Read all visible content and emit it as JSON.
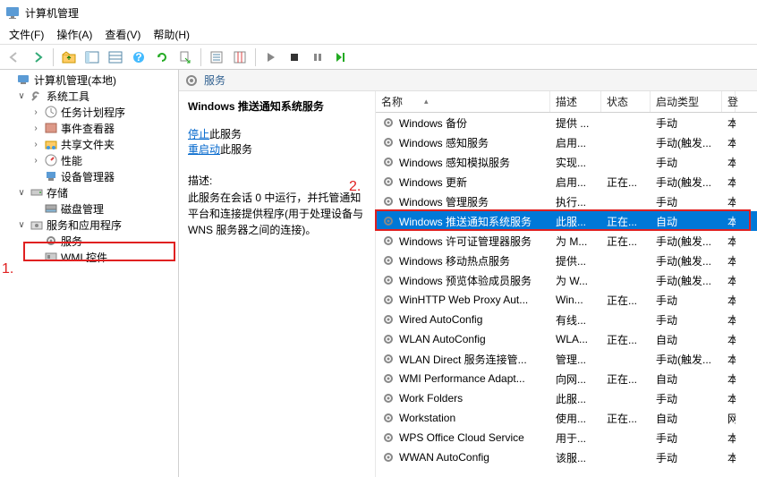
{
  "window": {
    "title": "计算机管理"
  },
  "menu": {
    "file": "文件(F)",
    "action": "操作(A)",
    "view": "查看(V)",
    "help": "帮助(H)"
  },
  "toolbar_icons": [
    "back",
    "forward",
    "up",
    "show-hide",
    "view-list",
    "help",
    "refresh",
    "export",
    "properties",
    "columns",
    "play",
    "stop",
    "pause",
    "restart"
  ],
  "tree": {
    "root": "计算机管理(本地)",
    "sys_tools": "系统工具",
    "task_sched": "任务计划程序",
    "event_viewer": "事件查看器",
    "shared": "共享文件夹",
    "perf": "性能",
    "devmgr": "设备管理器",
    "storage": "存储",
    "diskmgmt": "磁盘管理",
    "svc_apps": "服务和应用程序",
    "services": "服务",
    "wmi": "WMI 控件"
  },
  "annotations": {
    "a1": "1.",
    "a2": "2."
  },
  "svchdr": {
    "title": "服务"
  },
  "detail": {
    "name": "Windows 推送通知系统服务",
    "stop_pre": "停止",
    "stop_post": "此服务",
    "restart_pre": "重启动",
    "restart_post": "此服务",
    "desc_label": "描述:",
    "desc_text": "此服务在会话 0 中运行，并托管通知平台和连接提供程序(用于处理设备与 WNS 服务器之间的连接)。"
  },
  "cols": {
    "name": "名称",
    "desc": "描述",
    "stat": "状态",
    "start": "启动类型",
    "logon": "登"
  },
  "services": [
    {
      "name": "Windows 备份",
      "desc": "提供 ...",
      "stat": "",
      "start": "手动",
      "logon": "本"
    },
    {
      "name": "Windows 感知服务",
      "desc": "启用...",
      "stat": "",
      "start": "手动(触发...",
      "logon": "本"
    },
    {
      "name": "Windows 感知模拟服务",
      "desc": "实现...",
      "stat": "",
      "start": "手动",
      "logon": "本"
    },
    {
      "name": "Windows 更新",
      "desc": "启用...",
      "stat": "正在...",
      "start": "手动(触发...",
      "logon": "本"
    },
    {
      "name": "Windows 管理服务",
      "desc": "执行...",
      "stat": "",
      "start": "手动",
      "logon": "本"
    },
    {
      "name": "Windows 推送通知系统服务",
      "desc": "此服...",
      "stat": "正在...",
      "start": "自动",
      "logon": "本",
      "selected": true
    },
    {
      "name": "Windows 许可证管理器服务",
      "desc": "为 M...",
      "stat": "正在...",
      "start": "手动(触发...",
      "logon": "本"
    },
    {
      "name": "Windows 移动热点服务",
      "desc": "提供...",
      "stat": "",
      "start": "手动(触发...",
      "logon": "本"
    },
    {
      "name": "Windows 预览体验成员服务",
      "desc": "为 W...",
      "stat": "",
      "start": "手动(触发...",
      "logon": "本"
    },
    {
      "name": "WinHTTP Web Proxy Aut...",
      "desc": "Win...",
      "stat": "正在...",
      "start": "手动",
      "logon": "本"
    },
    {
      "name": "Wired AutoConfig",
      "desc": "有线...",
      "stat": "",
      "start": "手动",
      "logon": "本"
    },
    {
      "name": "WLAN AutoConfig",
      "desc": "WLA...",
      "stat": "正在...",
      "start": "自动",
      "logon": "本"
    },
    {
      "name": "WLAN Direct 服务连接管...",
      "desc": "管理...",
      "stat": "",
      "start": "手动(触发...",
      "logon": "本"
    },
    {
      "name": "WMI Performance Adapt...",
      "desc": "向网...",
      "stat": "正在...",
      "start": "自动",
      "logon": "本"
    },
    {
      "name": "Work Folders",
      "desc": "此服...",
      "stat": "",
      "start": "手动",
      "logon": "本"
    },
    {
      "name": "Workstation",
      "desc": "使用...",
      "stat": "正在...",
      "start": "自动",
      "logon": "网"
    },
    {
      "name": "WPS Office Cloud Service",
      "desc": "用于...",
      "stat": "",
      "start": "手动",
      "logon": "本"
    },
    {
      "name": "WWAN AutoConfig",
      "desc": "该服...",
      "stat": "",
      "start": "手动",
      "logon": "本"
    }
  ]
}
